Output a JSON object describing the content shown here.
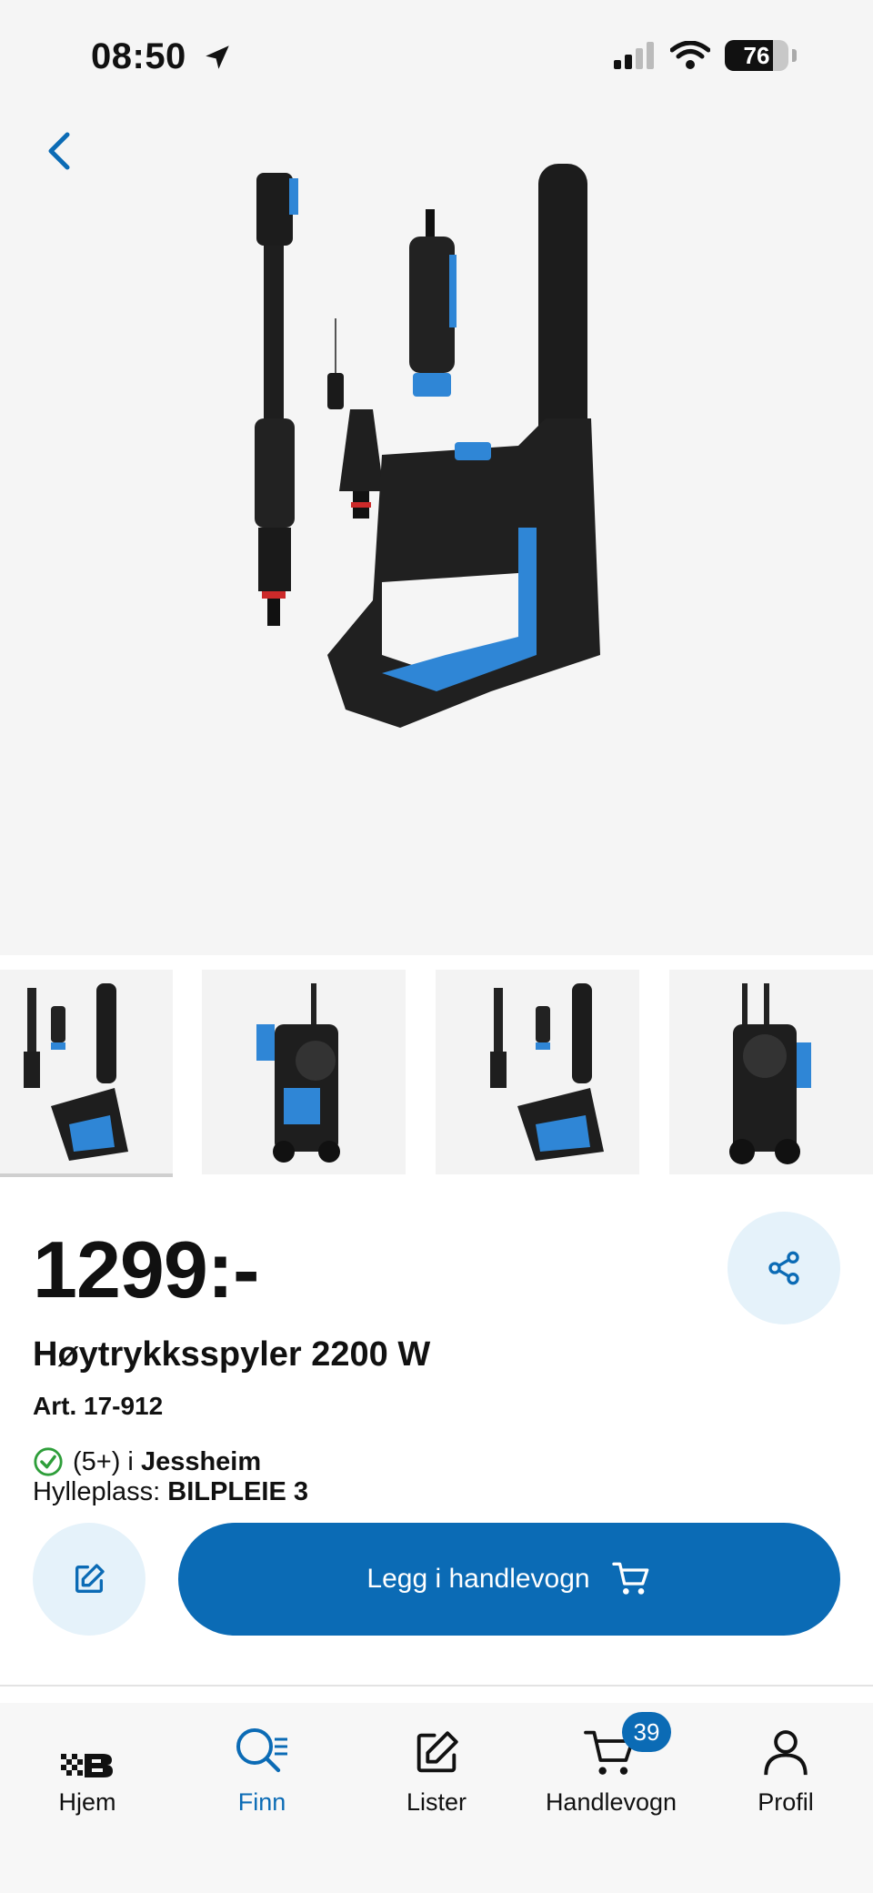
{
  "status": {
    "time": "08:50",
    "battery": "76",
    "battery_level": 0.76
  },
  "product": {
    "price": "1299:-",
    "name": "Høytrykksspyler 2200 W",
    "article": "Art. 17-912",
    "stock_count": "(5+) i",
    "stock_store": "Jessheim",
    "shelf_label": "Hylleplass:",
    "shelf_value": "BILPLEIE 3"
  },
  "actions": {
    "add_to_cart": "Legg i handlevogn"
  },
  "tabs": [
    {
      "label": "Hjem",
      "icon": "home-logo-icon"
    },
    {
      "label": "Finn",
      "icon": "search-icon"
    },
    {
      "label": "Lister",
      "icon": "edit-list-icon"
    },
    {
      "label": "Handlevogn",
      "icon": "cart-icon",
      "badge": "39"
    },
    {
      "label": "Profil",
      "icon": "profile-icon"
    }
  ],
  "colors": {
    "accent": "#0b6bb5",
    "accent_light": "#e5f2fa",
    "product_blue": "#2f86d6"
  }
}
